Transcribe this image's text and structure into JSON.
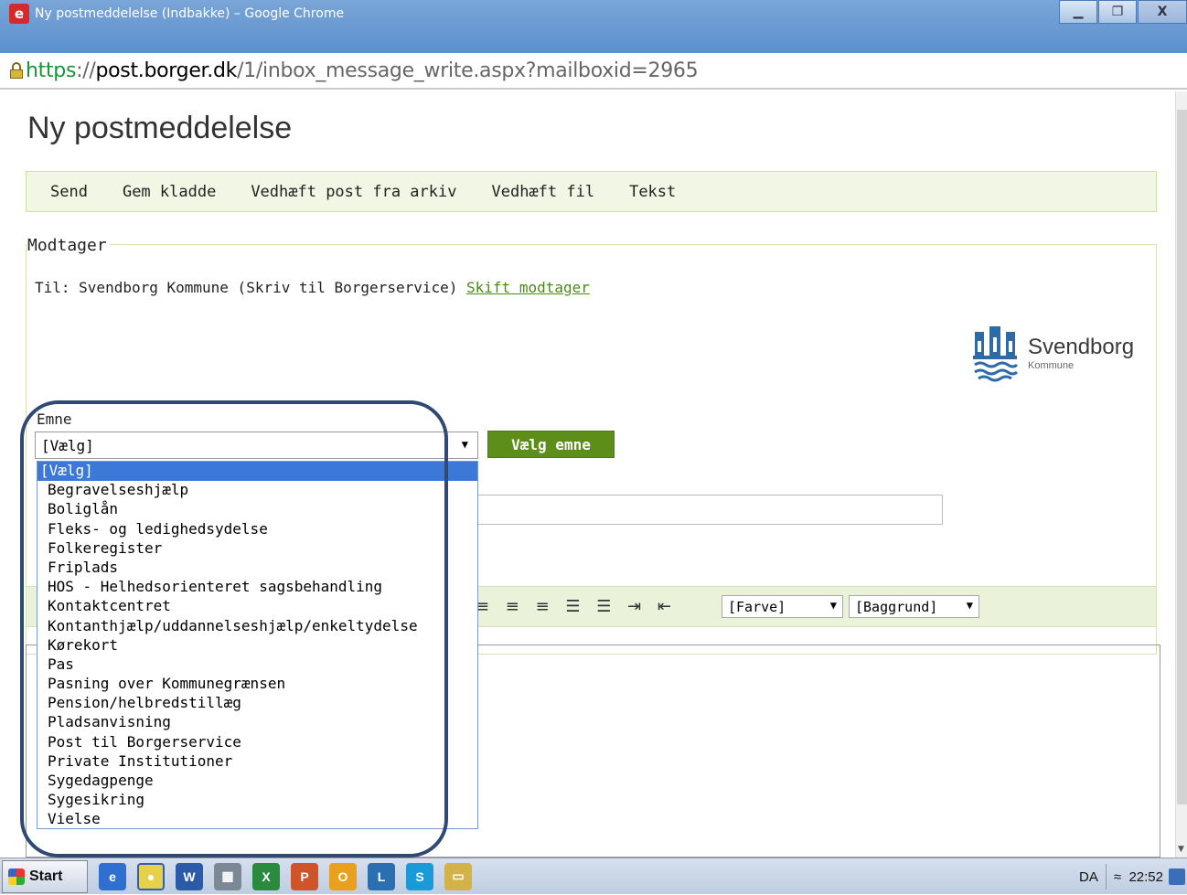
{
  "window": {
    "app_icon": "e",
    "title": "Ny postmeddelelse (Indbakke) – Google Chrome",
    "minimize_icon": "▁",
    "restore_icon": "❐",
    "close_icon": "X"
  },
  "address": {
    "scheme": "https",
    "sep": "://",
    "host": "post.borger.dk",
    "path": "/1/inbox_message_write.aspx?mailboxid=2965"
  },
  "page": {
    "title": "Ny postmeddelelse"
  },
  "toolbar": {
    "send": "Send",
    "save_draft": "Gem kladde",
    "attach_archive": "Vedhæft post fra arkiv",
    "attach_file": "Vedhæft fil",
    "text": "Tekst"
  },
  "recipient": {
    "legend": "Modtager",
    "to_text": "Til: Svendborg Kommune (Skriv til Borgerservice)",
    "change_link": "Skift modtager",
    "logo_name": "Svendborg",
    "logo_sub": "Kommune"
  },
  "subject": {
    "label": "Emne",
    "selected": "[Vælg]",
    "choose_button": "Vælg emne",
    "options": [
      "[Vælg]",
      "Begravelseshjælp",
      "Boliglån",
      "Fleks- og ledighedsydelse",
      "Folkeregister",
      "Friplads",
      "HOS - Helhedsorienteret sagsbehandling",
      "Kontaktcentret",
      "Kontanthjælp/uddannelseshjælp/enkeltydelse",
      "Kørekort",
      "Pas",
      "Pasning over Kommunegrænsen",
      "Pension/helbredstillæg",
      "Pladsanvisning",
      "Post til Borgerservice",
      "Private Institutioner",
      "Sygedagpenge",
      "Sygesikring",
      "Vielse"
    ]
  },
  "format": {
    "icons": "≡ ≡ ≡ ☰ ☰ ⇥ ⇤",
    "color": "[Farve]",
    "background": "[Baggrund]"
  },
  "taskbar": {
    "start": "Start",
    "lang": "DA",
    "tray_arrow": "≈",
    "clock": "22:52"
  }
}
